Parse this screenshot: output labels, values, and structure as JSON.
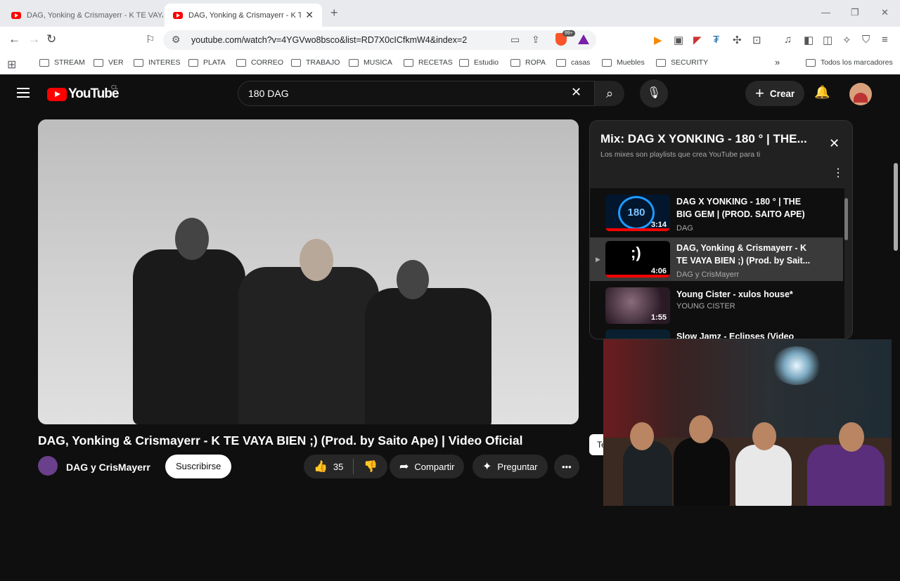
{
  "browser": {
    "tabs": [
      {
        "title": "DAG, Yonking & Crismayerr - K TE VAYA",
        "active": false
      },
      {
        "title": "DAG, Yonking & Crismayerr - K TE V",
        "active": true
      }
    ],
    "url": "youtube.com/watch?v=4YGVwo8bsco&list=RD7X0cICfkmW4&index=2",
    "extension_badge": "99+",
    "bookmarks": [
      "STREAM",
      "VER",
      "INTERES",
      "PLATA",
      "CORREO",
      "TRABAJO",
      "MUSICA",
      "RECETAS",
      "Estudio",
      "ROPA",
      "casas",
      "Muebles",
      "SECURITY"
    ],
    "all_bookmarks": "Todos los marcadores"
  },
  "youtube": {
    "logo_text": "YouTube",
    "country_code": "CL",
    "search_query": "180 DAG",
    "create_label": "Crear",
    "video": {
      "title": "DAG, Yonking & Crismayerr - K TE VAYA BIEN ;) (Prod. by Saito Ape) | Video Oficial",
      "channel": "DAG y CrisMayerr",
      "subscribe_label": "Suscribirse",
      "likes": "35",
      "share_label": "Compartir",
      "ask_label": "Preguntar"
    },
    "mix": {
      "title": "Mix: DAG X YONKING - 180 ° | THE...",
      "subtitle": "Los mixes son playlists que crea YouTube para ti",
      "items": [
        {
          "title": "DAG X YONKING - 180 ° | THE BIG GEM | (PROD. SAITO APE)",
          "channel": "DAG",
          "duration": "3:14",
          "thumb_text": "180"
        },
        {
          "title": "DAG, Yonking & Crismayerr - K TE VAYA BIEN ;) (Prod. by Sait...",
          "channel": "DAG y CrisMayerr",
          "duration": "4:06",
          "thumb_text": ";)"
        },
        {
          "title": "Young Cister - xulos house*",
          "channel": "YOUNG CISTER",
          "duration": "1:55"
        },
        {
          "title": "Slow Jamz - Eclipses (Video",
          "channel": "",
          "duration": ""
        }
      ]
    },
    "edge_card_text": "Te"
  }
}
